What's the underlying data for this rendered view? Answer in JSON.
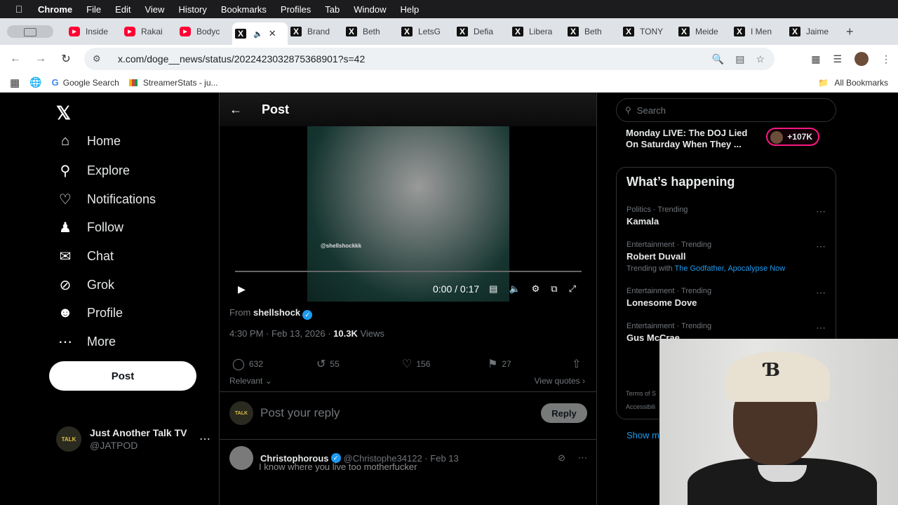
{
  "menubar": {
    "app": "Chrome",
    "items": [
      "File",
      "Edit",
      "View",
      "History",
      "Bookmarks",
      "Profiles",
      "Tab",
      "Window",
      "Help"
    ]
  },
  "tabs": [
    {
      "label": "Inside",
      "kind": "yt"
    },
    {
      "label": "Rakai",
      "kind": "yt"
    },
    {
      "label": "Bodyc",
      "kind": "yt"
    },
    {
      "label": "",
      "kind": "x",
      "active": true
    },
    {
      "label": "Brand",
      "kind": "x"
    },
    {
      "label": "Beth",
      "kind": "x"
    },
    {
      "label": "LetsG",
      "kind": "x"
    },
    {
      "label": "Defia",
      "kind": "x"
    },
    {
      "label": "Libera",
      "kind": "x"
    },
    {
      "label": "Beth",
      "kind": "x"
    },
    {
      "label": "TONY",
      "kind": "x"
    },
    {
      "label": "Meide",
      "kind": "x"
    },
    {
      "label": "I Men",
      "kind": "x"
    },
    {
      "label": "Jaime",
      "kind": "x"
    }
  ],
  "toolbar": {
    "url": "x.com/doge__news/status/2022423032875368901?s=42"
  },
  "bookmarks": {
    "items": [
      "Google Search",
      "StreamerStats - ju..."
    ],
    "all": "All Bookmarks"
  },
  "nav": {
    "items": [
      "Home",
      "Explore",
      "Notifications",
      "Follow",
      "Chat",
      "Grok",
      "Profile",
      "More"
    ],
    "post_button": "Post",
    "account": {
      "name": "Just Another Talk TV",
      "handle": "@JATPOD",
      "avatar_text": "TALK"
    }
  },
  "post": {
    "header": "Post",
    "watermark": "@shellshockkk",
    "video_time": "0:00 / 0:17",
    "from_label": "From",
    "from_name": "shellshock",
    "time": "4:30 PM · Feb 13, 2026 ·",
    "views_count": "10.3K",
    "views_label": "Views",
    "replies": "632",
    "reposts": "55",
    "likes": "156",
    "bookmarks": "27",
    "relevant": "Relevant",
    "view_quotes": "View quotes",
    "reply_placeholder": "Post your reply",
    "reply_button": "Reply"
  },
  "comment": {
    "name": "Christophorous",
    "handle": "@Christophe34122 · Feb 13",
    "text": "I know where you live too motherfucker"
  },
  "right": {
    "search_placeholder": "Search",
    "live_title": "Monday LIVE: The DOJ Lied On Saturday When They ...",
    "live_count": "+107K",
    "trending_title": "What’s happening",
    "trends": [
      {
        "cat": "Politics · Trending",
        "name": "Kamala"
      },
      {
        "cat": "Entertainment · Trending",
        "name": "Robert Duvall",
        "with_label": "Trending with",
        "with": "The Godfather, Apocalypse Now"
      },
      {
        "cat": "Entertainment · Trending",
        "name": "Lonesome Dove"
      },
      {
        "cat": "Entertainment · Trending",
        "name": "Gus McCrae"
      }
    ],
    "show_more": "Show m",
    "footer": [
      "Terms of S",
      "Accessibili"
    ]
  },
  "colors": {
    "x_blue": "#1d9bf0",
    "live_pink": "#f91880",
    "yt_red": "#ff0033"
  }
}
